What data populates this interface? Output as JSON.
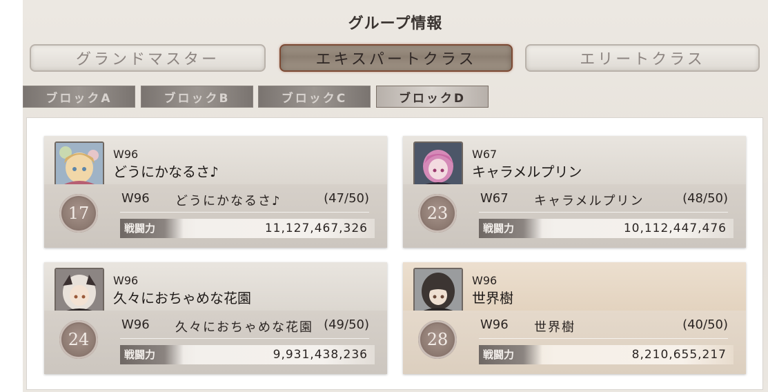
{
  "header": {
    "title": "グループ情報"
  },
  "class_tabs": [
    {
      "label": "グランドマスター",
      "active": false
    },
    {
      "label": "エキスパートクラス",
      "active": true
    },
    {
      "label": "エリートクラス",
      "active": false
    }
  ],
  "block_tabs": [
    {
      "label": "ブロックA",
      "active": false
    },
    {
      "label": "ブロックB",
      "active": false
    },
    {
      "label": "ブロックC",
      "active": false
    },
    {
      "label": "ブロックD",
      "active": true
    }
  ],
  "power_label": "戦闘力",
  "groups": [
    {
      "server": "W96",
      "name": "どうにかなるさ♪",
      "rank": "17",
      "members": "(47/50)",
      "power": "11,127,467,326"
    },
    {
      "server": "W67",
      "name": "キャラメルプリン",
      "rank": "23",
      "members": "(48/50)",
      "power": "10,112,447,476"
    },
    {
      "server": "W96",
      "name": "久々におちゃめな花園",
      "rank": "24",
      "members": "(49/50)",
      "power": "9,931,438,236"
    },
    {
      "server": "W96",
      "name": "世界樹",
      "rank": "28",
      "members": "(40/50)",
      "power": "8,210,655,217",
      "highlighted": true
    }
  ]
}
